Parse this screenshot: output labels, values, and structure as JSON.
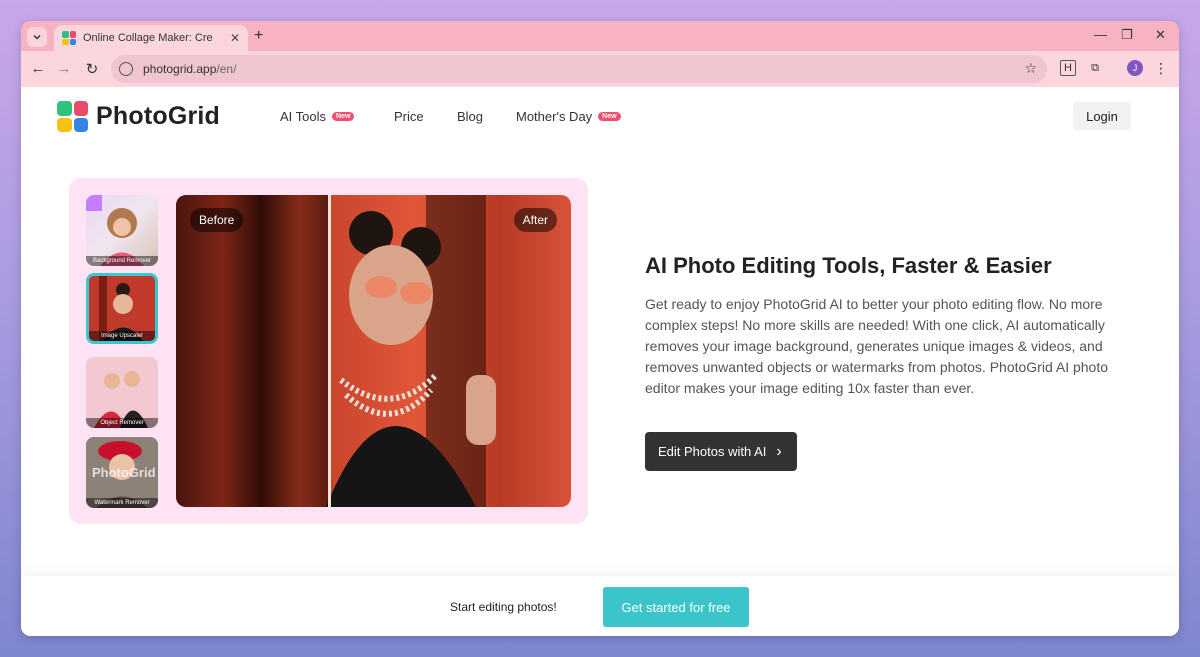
{
  "browser": {
    "tab_title": "Online Collage Maker: Create Fr",
    "url_host": "photogrid.app",
    "url_path": "/en/",
    "avatar_initial": "J",
    "ext_letter": "H"
  },
  "header": {
    "logo_text": "PhotoGrid",
    "nav": [
      {
        "label": "AI Tools",
        "badge": "New"
      },
      {
        "label": "Price"
      },
      {
        "label": "Blog"
      },
      {
        "label": "Mother's Day",
        "badge": "New"
      }
    ],
    "login_label": "Login"
  },
  "hero": {
    "thumbnails": [
      {
        "label": "Background Remover"
      },
      {
        "label": "Image Upscaler"
      },
      {
        "label": "Object Remover"
      },
      {
        "label": "Watermark Remover",
        "watermark": "PhotoGrid"
      }
    ],
    "before_label": "Before",
    "after_label": "After",
    "title": "AI Photo Editing Tools, Faster & Easier",
    "description": "Get ready to enjoy PhotoGrid AI to better your photo editing flow. No more complex steps! No more skills are needed! With one click, AI automatically removes your image background, generates unique images & videos, and removes unwanted objects or watermarks from photos. PhotoGrid AI photo editor makes your image editing 10x faster than ever.",
    "cta_label": "Edit Photos with AI"
  },
  "bottom_bar": {
    "text": "Start editing photos!",
    "button_label": "Get started for free"
  },
  "colors": {
    "accent": "#3bc4c9",
    "badge": "#f0506e",
    "tab_strip": "#f7b3c1"
  }
}
